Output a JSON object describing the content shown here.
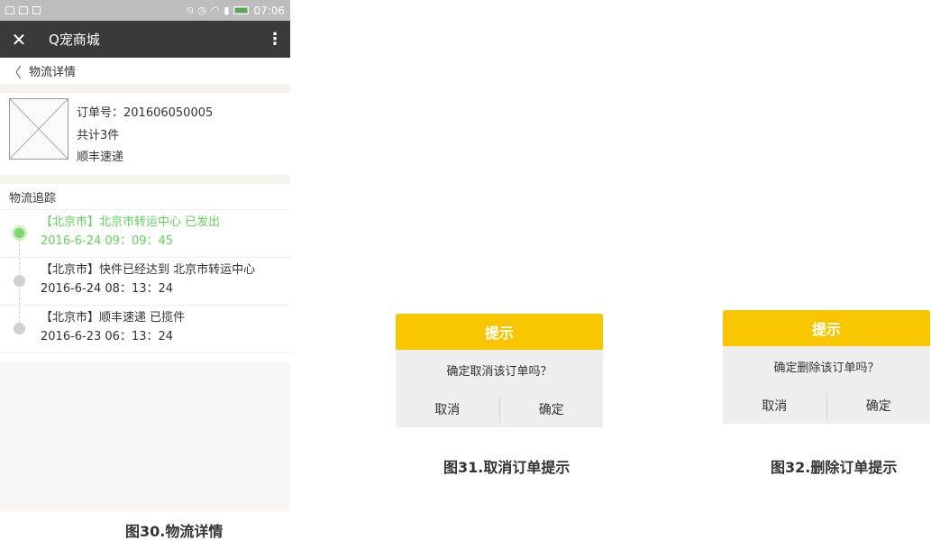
{
  "phone": {
    "status": {
      "time": "07:06"
    },
    "appbar": {
      "title": "Q宠商城",
      "close_glyph": "✕",
      "more_glyph": "⋮"
    },
    "subheader": {
      "title": "物流详情",
      "back_glyph": "〈"
    },
    "order": {
      "number": "订单号：201606050005",
      "count": "共计3件",
      "carrier": "顺丰速递"
    },
    "tracking": {
      "title": "物流追踪",
      "items": [
        {
          "place": "【北京市】北京市转运中心 已发出",
          "time": "2016-6-24 09：09：45"
        },
        {
          "place": "【北京市】快件已经达到 北京市转运中心",
          "time": "2016-6-24 08：13：24"
        },
        {
          "place": "【北京市】顺丰速递 已揽件",
          "time": "2016-6-23 06：13：24"
        }
      ]
    }
  },
  "dialogs": [
    {
      "title": "提示",
      "message": "确定取消该订单吗？",
      "cancel": "取消",
      "confirm": "确定"
    },
    {
      "title": "提示",
      "message": "确定删除该订单吗？",
      "cancel": "取消",
      "confirm": "确定"
    }
  ],
  "captions": {
    "fig30": "图30.物流详情",
    "fig31": "图31.取消订单提示",
    "fig32": "图32.删除订单提示"
  },
  "colors": {
    "accent": "#f7c600",
    "active_green": "#5fd35a",
    "appbar": "#3a3a3a"
  }
}
